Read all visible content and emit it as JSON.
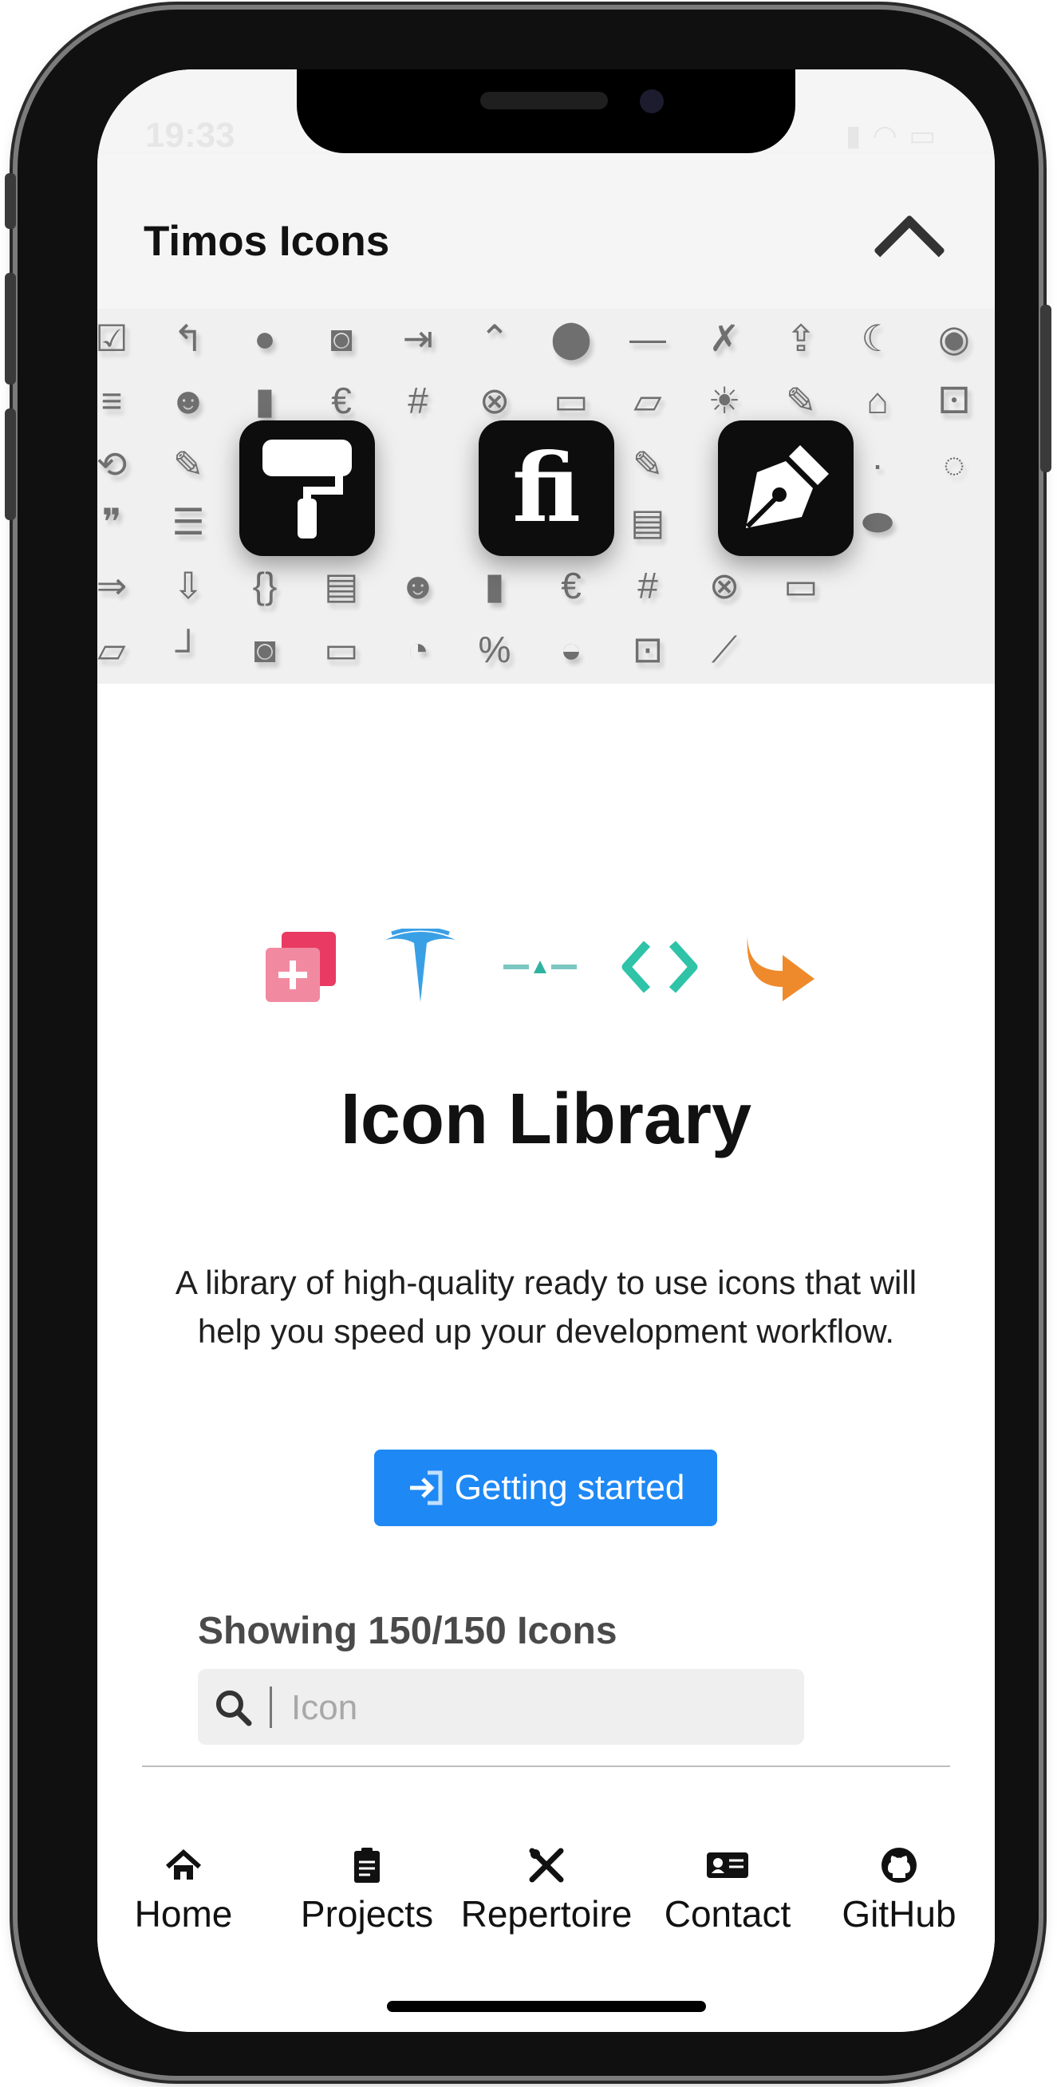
{
  "status_bar": {
    "time": "19:33"
  },
  "header": {
    "title": "Timos Icons",
    "collapse_icon": "chevron-up-icon"
  },
  "hero": {
    "background_icons": [
      "check",
      "reply",
      "user",
      "camera",
      "login",
      "chevrons-up",
      "circle",
      "dash",
      "user-x",
      "upload",
      "moon",
      "github",
      "close"
    ],
    "app_tiles": [
      {
        "name": "paint-roller-icon",
        "glyph": "⧗"
      },
      {
        "name": "fi-logo-icon",
        "glyph": "fi"
      },
      {
        "name": "pen-nib-icon",
        "glyph": "✒"
      }
    ]
  },
  "features": {
    "icons": [
      "duplicate-plus-icon",
      "tesla-icon",
      "split-icon",
      "code-icon",
      "forward-arrow-icon"
    ],
    "colors": {
      "duplicate": "#ee5a78",
      "tesla": "#3aa0e6",
      "split": "#7cc7c2",
      "code": "#2fc3a8",
      "forward": "#ee8a2c"
    }
  },
  "main": {
    "title": "Icon Library",
    "description": "A library of high-quality ready to use icons that will help you speed up your development workflow.",
    "cta_label": "Getting started",
    "count_label": "Showing 150/150 Icons",
    "search_placeholder": "Icon"
  },
  "tabbar": {
    "items": [
      {
        "label": "Home",
        "icon": "home-icon"
      },
      {
        "label": "Projects",
        "icon": "clipboard-icon"
      },
      {
        "label": "Repertoire",
        "icon": "tools-icon"
      },
      {
        "label": "Contact",
        "icon": "id-card-icon"
      },
      {
        "label": "GitHub",
        "icon": "github-icon"
      }
    ]
  },
  "colors": {
    "accent": "#1e88f5",
    "header_bg": "#f5f5f5"
  }
}
